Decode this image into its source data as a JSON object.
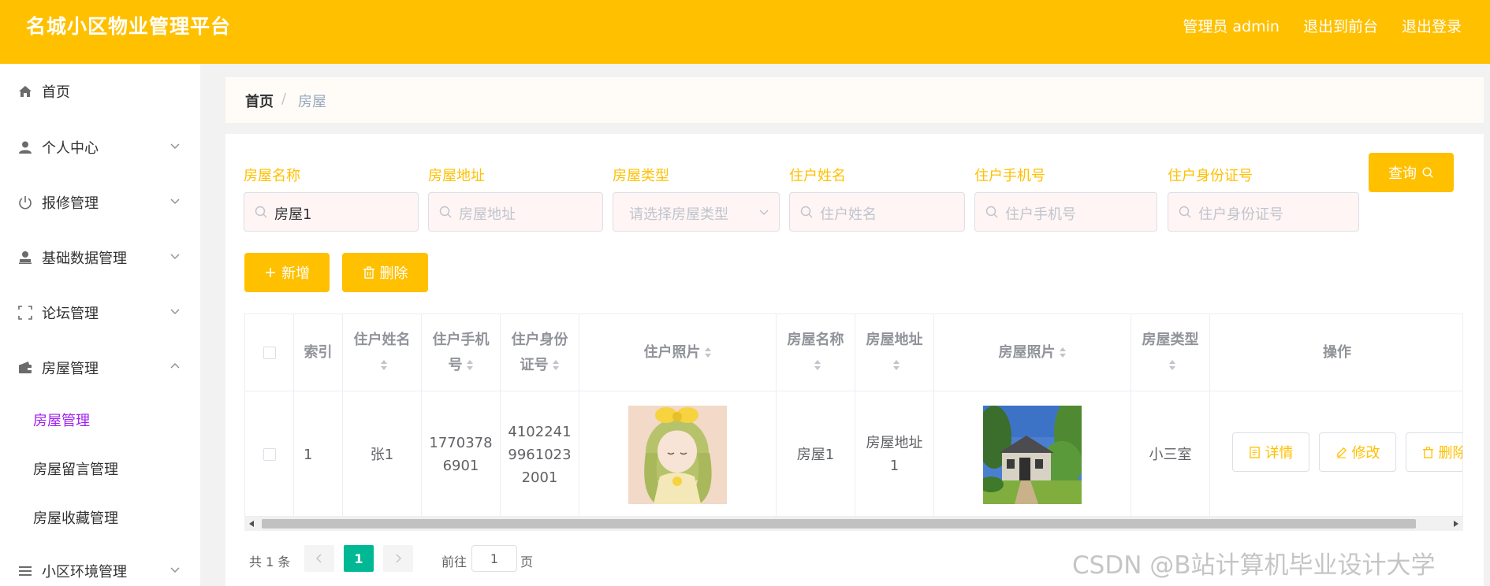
{
  "header": {
    "title": "名城小区物业管理平台",
    "admin_label": "管理员 admin",
    "frontend_label": "退出到前台",
    "logout_label": "退出登录",
    "color": "#ffc000"
  },
  "sidebar": {
    "items": [
      {
        "label": "首页",
        "icon": "home-icon"
      },
      {
        "label": "个人中心",
        "icon": "user-icon"
      },
      {
        "label": "报修管理",
        "icon": "power-icon"
      },
      {
        "label": "基础数据管理",
        "icon": "person-stamp-icon"
      },
      {
        "label": "论坛管理",
        "icon": "frame-icon"
      },
      {
        "label": "房屋管理",
        "icon": "wallet-icon"
      },
      {
        "label": "小区环境管理",
        "icon": "list-icon"
      }
    ],
    "subitems": [
      "房屋管理",
      "房屋留言管理",
      "房屋收藏管理"
    ]
  },
  "breadcrumb": {
    "home": "首页",
    "separator": "/",
    "current": "房屋"
  },
  "search": {
    "fields": [
      {
        "label": "房屋名称",
        "value": "房屋1",
        "placeholder": ""
      },
      {
        "label": "房屋地址",
        "value": "",
        "placeholder": "房屋地址"
      },
      {
        "label": "房屋类型",
        "value": "",
        "placeholder": "请选择房屋类型"
      },
      {
        "label": "住户姓名",
        "value": "",
        "placeholder": "住户姓名"
      },
      {
        "label": "住户手机号",
        "value": "",
        "placeholder": "住户手机号"
      },
      {
        "label": "住户身份证号",
        "value": "",
        "placeholder": "住户身份证号"
      }
    ],
    "query_label": "查询"
  },
  "actions": {
    "add_label": "新增",
    "delete_label": "删除"
  },
  "table": {
    "headers": {
      "index": "索引",
      "name": [
        "住户姓名"
      ],
      "phone": [
        "住户手机",
        "号"
      ],
      "idcard": [
        "住户身份",
        "证号"
      ],
      "photo": "住户照片",
      "house_name": [
        "房屋名称"
      ],
      "house_addr": [
        "房屋地址"
      ],
      "house_photo": "房屋照片",
      "house_type": [
        "房屋类型"
      ],
      "operation": "操作"
    },
    "row": {
      "index": "1",
      "name": "张1",
      "phone": [
        "1770378",
        "6901"
      ],
      "idcard": [
        "4102241",
        "9961023",
        "2001"
      ],
      "house_name": "房屋1",
      "house_addr": [
        "房屋地址",
        "1"
      ],
      "house_type": "小三室",
      "ops": {
        "detail": "详情",
        "edit": "修改",
        "delete": "删除"
      }
    }
  },
  "pagination": {
    "total": "共 1 条",
    "current": "1",
    "goto": "前往",
    "goto_value": "1",
    "page": "页",
    "active_color": "#00b894"
  },
  "watermark": "CSDN @B站计算机毕业设计大学"
}
